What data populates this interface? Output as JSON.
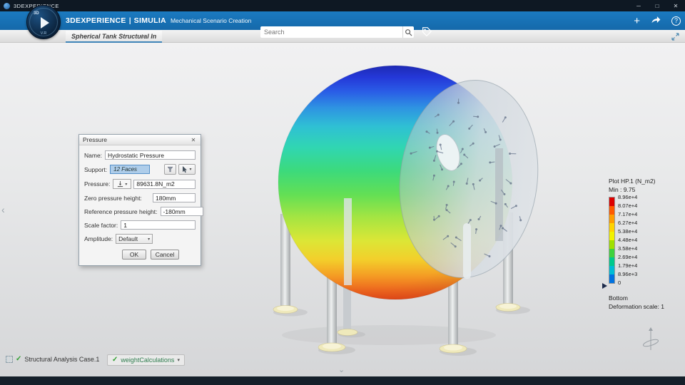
{
  "window": {
    "title": "3DEXPERIENCE",
    "minimize": "─",
    "maximize": "□",
    "close": "✕"
  },
  "header": {
    "brand": "3DEXPERIENCE",
    "divider": "|",
    "app": "SIMULIA",
    "module": "Mechanical Scenario Creation",
    "search_placeholder": "Search",
    "plus": "+",
    "help": "?"
  },
  "compass": {
    "top": "3D",
    "bottom": "V.R"
  },
  "tabs": {
    "active": "Spherical Tank Structural In",
    "add": "+"
  },
  "dialog": {
    "title": "Pressure",
    "close": "✕",
    "fields": [
      {
        "label": "Name:",
        "value": "Hydrostatic Pressure"
      },
      {
        "label": "Support:",
        "value": "12 Faces"
      },
      {
        "label": "Pressure:",
        "value": "89631.8N_m2"
      },
      {
        "label": "Zero pressure height:",
        "value": "180mm"
      },
      {
        "label": "Reference pressure height:",
        "value": "-180mm"
      },
      {
        "label": "Scale factor:",
        "value": "1"
      },
      {
        "label": "Amplitude:",
        "value": "Default"
      }
    ],
    "ok": "OK",
    "cancel": "Cancel"
  },
  "legend": {
    "title": "Plot HP.1 (N_m2)",
    "min": "Min : 9.75",
    "values": [
      "8.96e+4",
      "8.07e+4",
      "7.17e+4",
      "6.27e+4",
      "5.38e+4",
      "4.48e+4",
      "3.58e+4",
      "2.69e+4",
      "1.79e+4",
      "8.96e+3",
      "0"
    ],
    "colors": [
      "#dd0000",
      "#ff5a00",
      "#ff9d00",
      "#ffd300",
      "#f2f200",
      "#9fe000",
      "#3ed23e",
      "#00c98c",
      "#00bcd4",
      "#0072e0"
    ],
    "bottom_label": "Bottom",
    "deformation": "Deformation scale: 1"
  },
  "status": {
    "case": "Structural Analysis Case.1",
    "weight": "weightCalculations"
  }
}
